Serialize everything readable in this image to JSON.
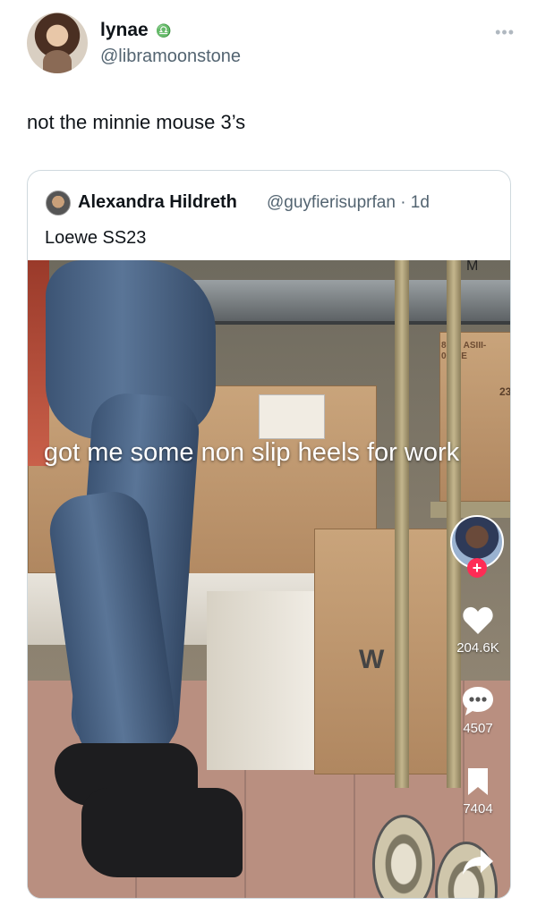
{
  "author": {
    "display_name": "lynae",
    "badge": "♎",
    "handle": "@libramoonstone",
    "more_icon": "more-horizontal-icon"
  },
  "tweet": {
    "text": "not the minnie mouse 3’s"
  },
  "quoted_tweet": {
    "display_name": "Alexandra Hildreth",
    "handle_time": "@guyfierisuprfan · 1d",
    "text": "Loewe SS23",
    "media": {
      "caption": "got me some non slip heels for work",
      "box_letter": "W",
      "box_code": "8010 ASIII-0010E",
      "box_number": "23",
      "box_top": "M",
      "likes": "204.6K",
      "comments": "4507",
      "saves": "7404",
      "icons": [
        "follow-plus-icon",
        "heart-icon",
        "comment-icon",
        "bookmark-icon",
        "share-icon"
      ],
      "accent_color": "#fe2c55"
    }
  }
}
